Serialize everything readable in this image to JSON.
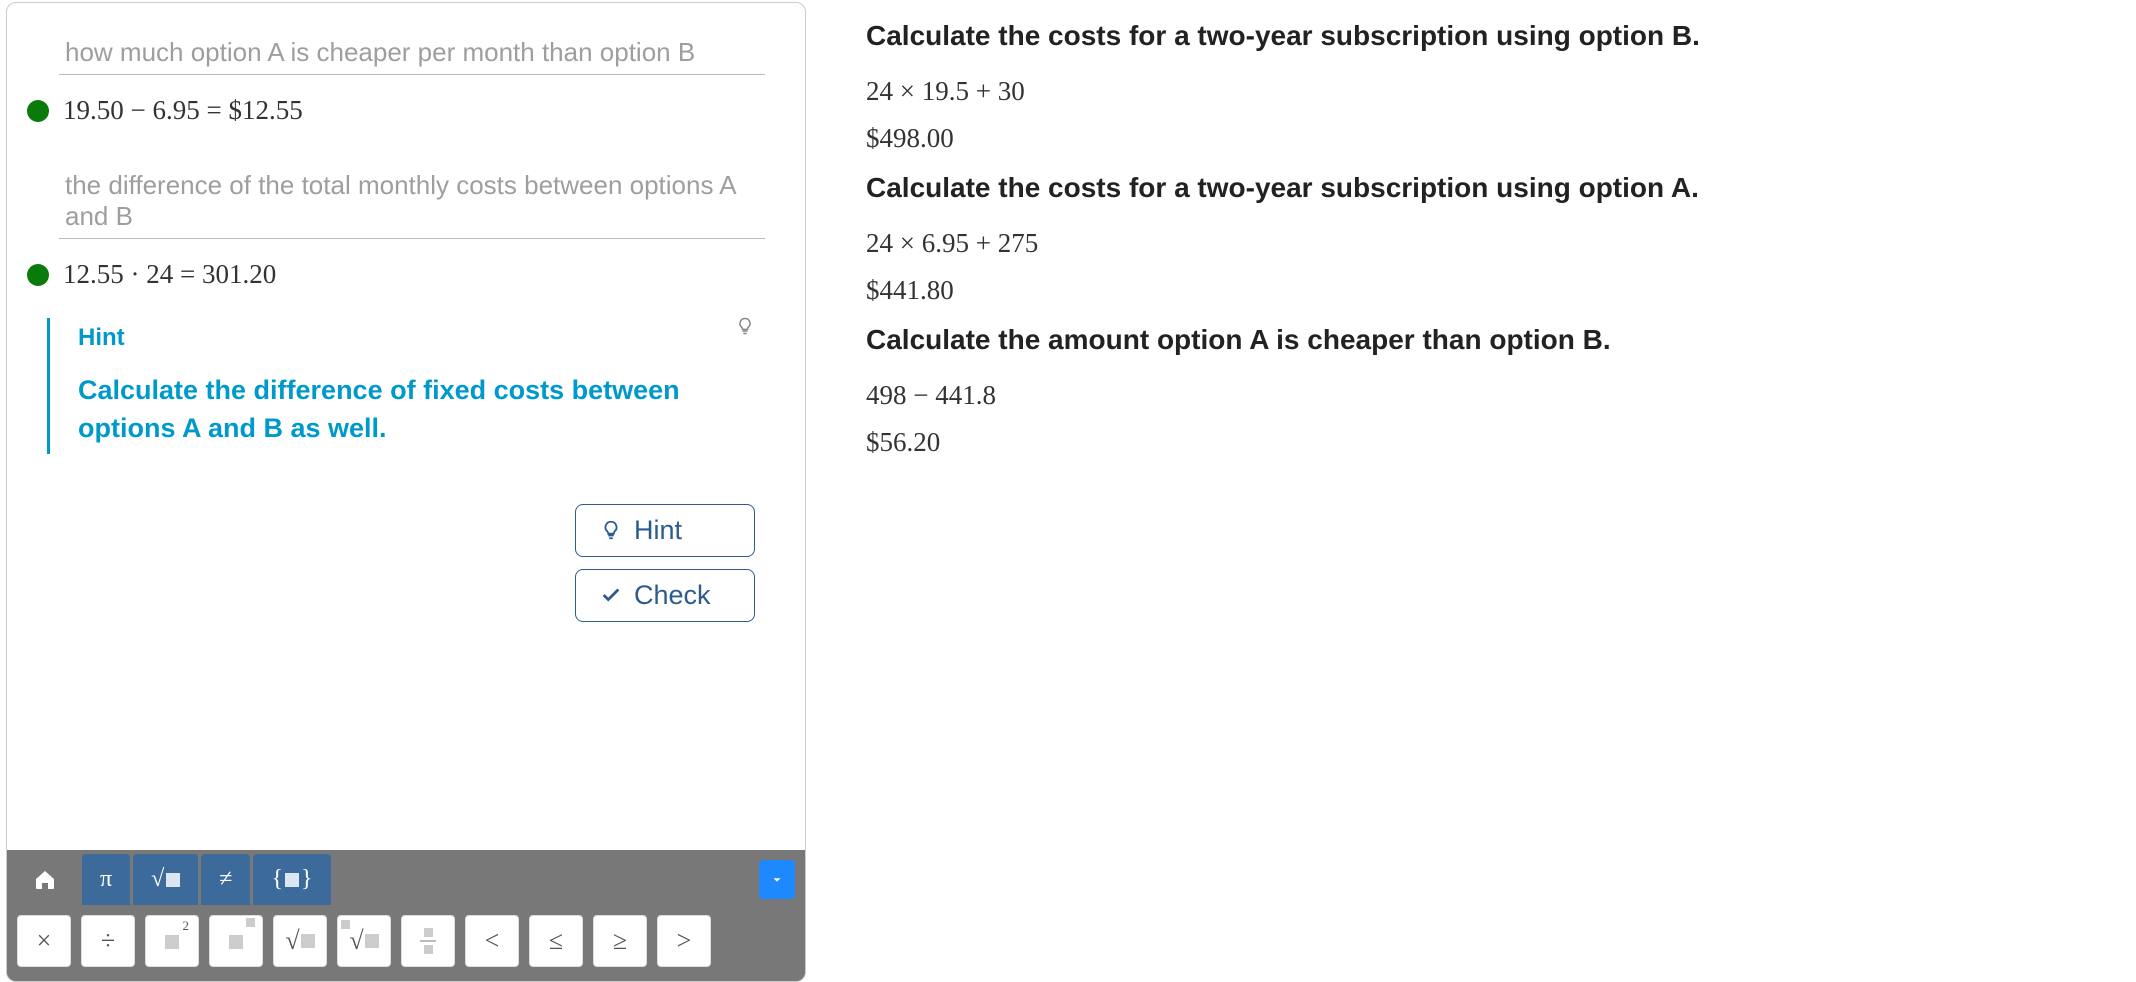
{
  "left": {
    "steps": [
      {
        "label": "how much option A is cheaper per month than option B",
        "bullet_color": "#0a7a0a",
        "math": "19.50 − 6.95 = $12.55"
      },
      {
        "label": "the difference of the total monthly costs between options A and B",
        "bullet_color": "#0a7a0a",
        "math": "12.55 · 24 = 301.20"
      }
    ],
    "hint": {
      "title": "Hint",
      "text": "Calculate the difference of fixed costs between options A and B as well."
    },
    "buttons": {
      "hint": "Hint",
      "check": "Check"
    },
    "toolbar": {
      "home_icon": "home",
      "tabs": [
        "π",
        "√■",
        "≠",
        "{■}"
      ],
      "dropdown_icon": "chevron-down",
      "keys": [
        "×",
        "÷",
        "■²",
        "■^■",
        "√■",
        "ⁿ√■",
        "■/■",
        "<",
        "≤",
        "≥",
        ">"
      ]
    }
  },
  "right": {
    "sections": [
      {
        "heading": "Calculate the costs for a two-year subscription using option B.",
        "lines": [
          "24 × 19.5 + 30",
          "$498.00"
        ]
      },
      {
        "heading": "Calculate the costs for a two-year subscription using option A.",
        "lines": [
          "24 × 6.95 + 275",
          "$441.80"
        ]
      },
      {
        "heading": "Calculate the amount option A is cheaper than option B.",
        "lines": [
          "498 − 441.8",
          "$56.20"
        ]
      }
    ]
  }
}
